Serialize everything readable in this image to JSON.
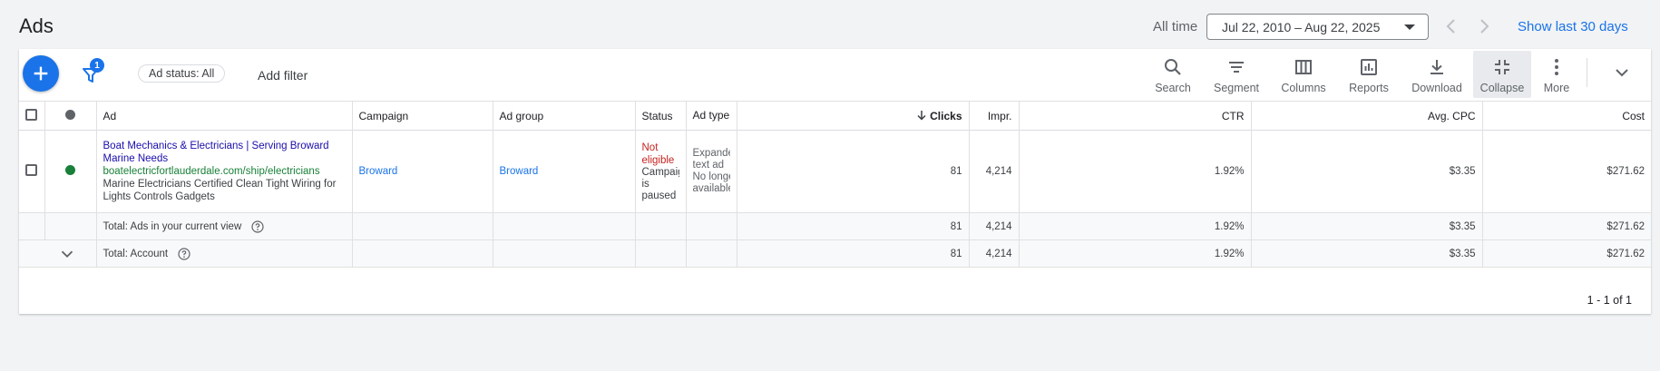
{
  "page": {
    "title": "Ads"
  },
  "date_range": {
    "label": "All time",
    "value": "Jul 22, 2010 – Aug 22, 2025",
    "show_last": "Show last 30 days"
  },
  "filters": {
    "badge_count": "1",
    "chip": "Ad status: All",
    "add_filter": "Add filter"
  },
  "toolbar": {
    "search": "Search",
    "segment": "Segment",
    "columns": "Columns",
    "reports": "Reports",
    "download": "Download",
    "collapse": "Collapse",
    "more": "More"
  },
  "table": {
    "headers": {
      "ad": "Ad",
      "campaign": "Campaign",
      "ad_group": "Ad group",
      "status": "Status",
      "ad_type": "Ad type",
      "clicks": "Clicks",
      "impr": "Impr.",
      "ctr": "CTR",
      "avg_cpc": "Avg. CPC",
      "cost": "Cost"
    },
    "row": {
      "headline": "Boat Mechanics & Electricians | Serving Broward Marine Needs",
      "url": "boatelectricfortlauderdale.com/ship/electricians",
      "description": "Marine Electricians Certified Clean Tight Wiring for Lights Controls Gadgets",
      "campaign": "Broward",
      "ad_group": "Broward",
      "status_main": "Not eligible",
      "status_sub": "Campaign is paused",
      "ad_type_line1": "Expanded",
      "ad_type_line2": "text ad",
      "ad_type_line3": "No longer",
      "ad_type_line4": "available",
      "clicks": "81",
      "impr": "4,214",
      "ctr": "1.92%",
      "avg_cpc": "$3.35",
      "cost": "$271.62"
    },
    "total_view": {
      "label": "Total: Ads in your current view",
      "clicks": "81",
      "impr": "4,214",
      "ctr": "1.92%",
      "avg_cpc": "$3.35",
      "cost": "$271.62"
    },
    "total_account": {
      "label": "Total: Account",
      "clicks": "81",
      "impr": "4,214",
      "ctr": "1.92%",
      "avg_cpc": "$3.35",
      "cost": "$271.62"
    }
  },
  "pagination": "1 - 1 of 1",
  "colors": {
    "accent": "#1a73e8",
    "status_red": "#c5221f",
    "url_green": "#188038",
    "headline": "#1a0dab"
  }
}
